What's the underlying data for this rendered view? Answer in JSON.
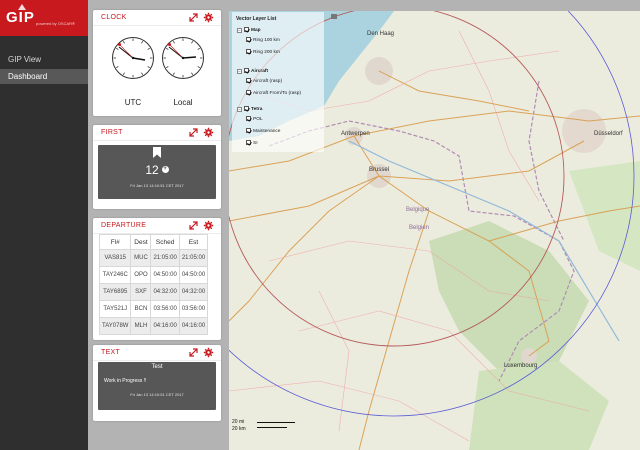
{
  "app": {
    "logo_text": "GIP",
    "logo_sub": "powered by OSCAR®",
    "brand_color": "#c8191e"
  },
  "nav": {
    "items": [
      {
        "label": "GIP View",
        "active": false
      },
      {
        "label": "Dashboard",
        "active": true
      }
    ]
  },
  "panels": {
    "clock": {
      "title": "CLOCK",
      "labels": [
        "UTC",
        "Local"
      ],
      "icons": [
        "expand-icon",
        "gear-icon"
      ]
    },
    "first": {
      "title": "FIRST",
      "count": "12",
      "timestamp": "Fri Jan 13 14:10:51 CET 2017",
      "icons": [
        "bookmark-icon",
        "plus-icon"
      ]
    },
    "departure": {
      "title": "DEPARTURE",
      "columns": [
        "Fl#",
        "Dest",
        "Sched",
        "Est"
      ],
      "rows": [
        [
          "VAS815",
          "MUC",
          "21:05:00",
          "21:05:00"
        ],
        [
          "TAY246C",
          "OPO",
          "04:50:00",
          "04:50:00"
        ],
        [
          "TAY6895",
          "SXF",
          "04:32:00",
          "04:32:00"
        ],
        [
          "TAY521J",
          "BCN",
          "03:56:00",
          "03:56:00"
        ],
        [
          "TAY078W",
          "MLH",
          "04:16:00",
          "04:16:00"
        ]
      ]
    },
    "text": {
      "title": "TEXT",
      "box_title": "Test",
      "body": "Work in Progress !!",
      "timestamp": "Fri Jan 13 14:10:51 CET 2017"
    }
  },
  "map": {
    "layer_list_title": "Vector Layer List",
    "groups": [
      {
        "name": "Map",
        "items": [
          "Ring 100 km",
          "Ring 200 km"
        ]
      },
      {
        "name": "Aircraft",
        "items": [
          "Aircraft (rasp)",
          "Aircraft From/To (rasp)"
        ]
      },
      {
        "name": "Tetra",
        "items": [
          "POL",
          "Maintenance",
          "SI"
        ]
      }
    ],
    "place_labels": [
      "Den Haag",
      "Antwerpen",
      "Brussel",
      "Belgique",
      "Belgien",
      "Luxembourg",
      "Düsseldorf"
    ],
    "scale_mi": "20 mi",
    "scale_km": "20 km",
    "ring_inner_color": "#b55a5a",
    "ring_outer_color": "#5b5bd6"
  }
}
